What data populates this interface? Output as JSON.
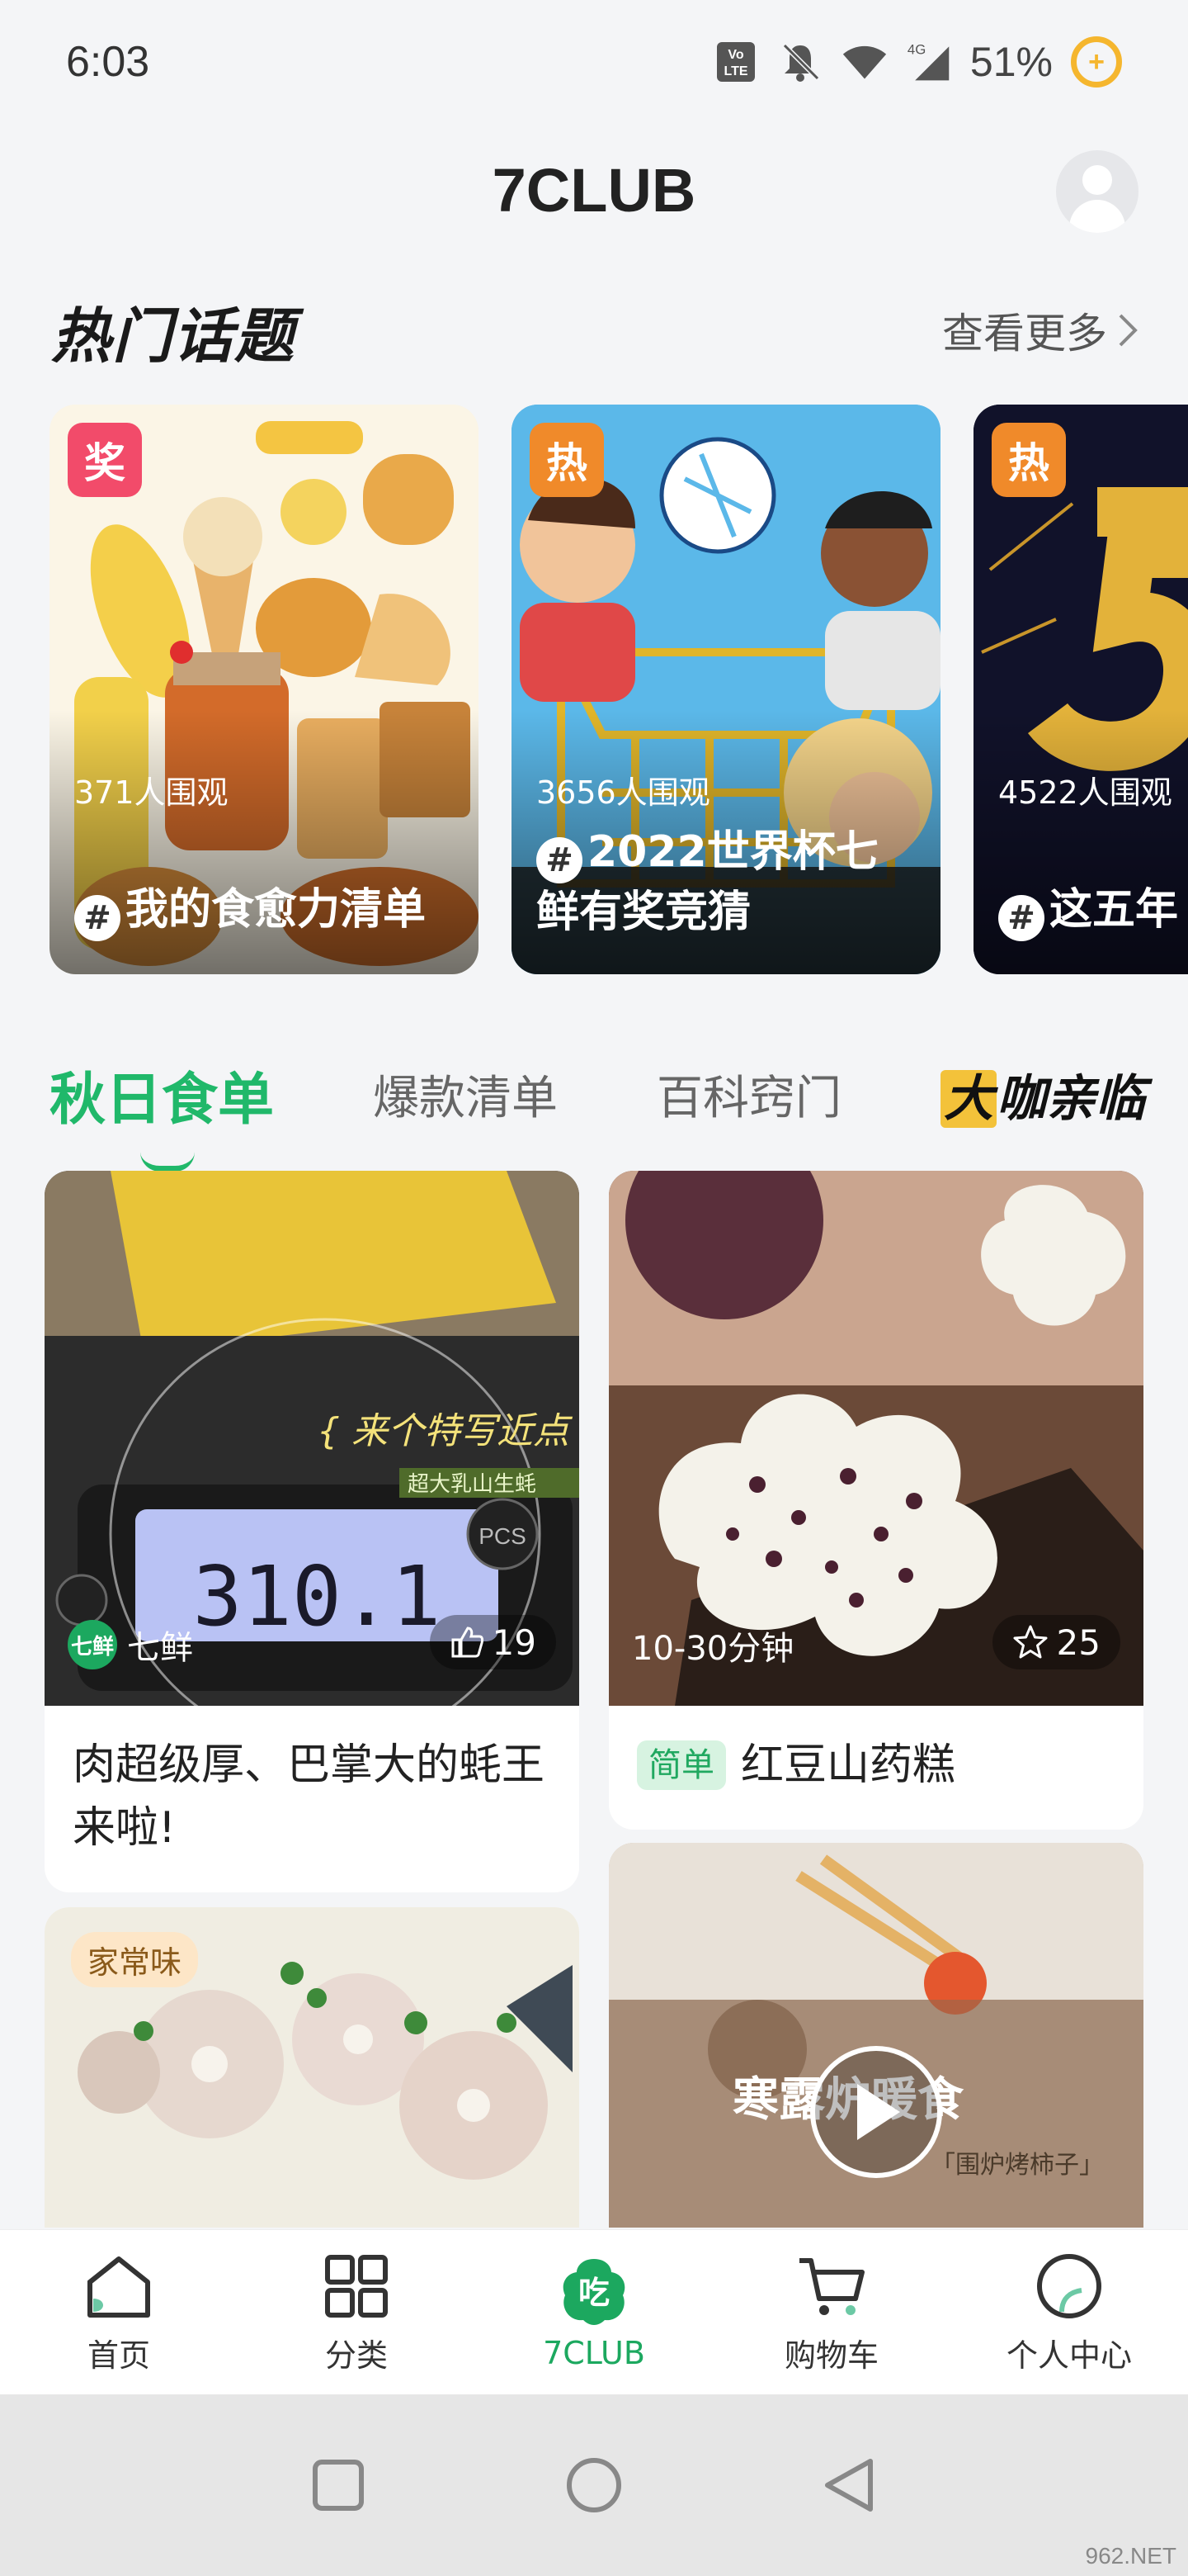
{
  "status": {
    "time": "6:03",
    "battery": "51%",
    "network": "4G"
  },
  "header": {
    "title": "7CLUB"
  },
  "hot": {
    "title": "热门话题",
    "more": "查看更多",
    "cards": [
      {
        "badge": "奖",
        "badge_color": "#f24b6a",
        "views": "371人围观",
        "title": "我的食愈力清单"
      },
      {
        "badge": "热",
        "badge_color": "#f08a2a",
        "views": "3656人围观",
        "title": "2022世界杯七鲜有奖竞猜"
      },
      {
        "badge": "热",
        "badge_color": "#f08a2a",
        "views": "4522人围观",
        "title": "这五年"
      }
    ]
  },
  "tabs": [
    {
      "label": "秋日食单"
    },
    {
      "label": "爆款清单"
    },
    {
      "label": "百科窍门"
    },
    {
      "label_hl": "大",
      "label_rest": "咖亲临"
    }
  ],
  "feed": {
    "card1": {
      "author": "七鲜",
      "logo": "七鲜",
      "likes": "19",
      "title": "肉超级厚、巴掌大的蚝王来啦!",
      "overlay_text": "{ 来个特写近点",
      "overlay_sub": "超大乳山生蚝",
      "scale_reading": "310.1"
    },
    "card2": {
      "time": "10-30分钟",
      "stars": "25",
      "tag": "简单",
      "title": "红豆山药糕"
    },
    "card3": {
      "tag": "家常味"
    },
    "card4": {
      "overlay_text": "寒露炉暖食",
      "overlay_sub": "「围炉烤柿子」"
    }
  },
  "nav": [
    {
      "label": "首页",
      "icon": "home-icon"
    },
    {
      "label": "分类",
      "icon": "category-icon"
    },
    {
      "label": "7CLUB",
      "icon": "eat-icon",
      "badge": "吃"
    },
    {
      "label": "购物车",
      "icon": "cart-icon"
    },
    {
      "label": "个人中心",
      "icon": "profile-icon"
    }
  ],
  "watermark": "962.NET",
  "colors": {
    "accent": "#1ca85f",
    "tab_active": "#20b86a"
  }
}
